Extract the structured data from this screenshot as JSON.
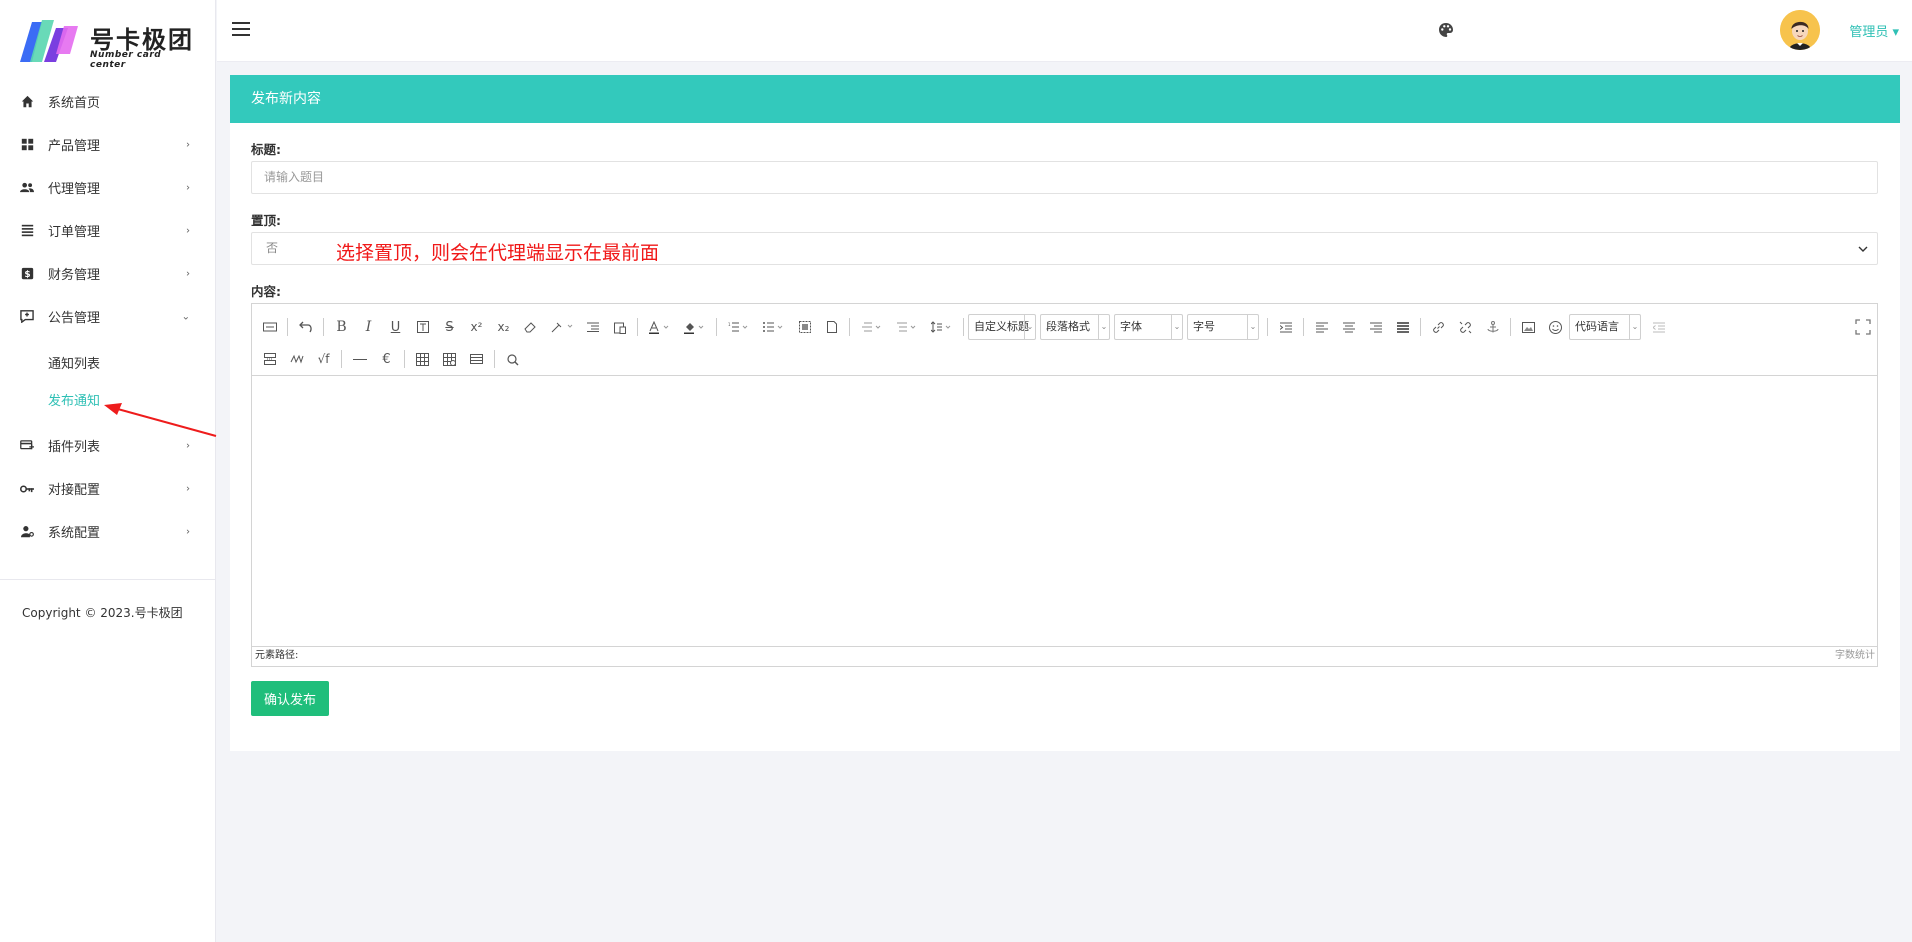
{
  "brand": {
    "title": "号卡极团",
    "subtitle": "Number card center"
  },
  "sidebar": {
    "items": [
      {
        "label": "系统首页",
        "icon": "home-icon",
        "chevron": ""
      },
      {
        "label": "产品管理",
        "icon": "grid-icon",
        "chevron": "›"
      },
      {
        "label": "代理管理",
        "icon": "users-icon",
        "chevron": "›"
      },
      {
        "label": "订单管理",
        "icon": "list-icon",
        "chevron": "›"
      },
      {
        "label": "财务管理",
        "icon": "dollar-icon",
        "chevron": "›"
      },
      {
        "label": "公告管理",
        "icon": "announcement-icon",
        "chevron": "⌄"
      }
    ],
    "sub_items": [
      {
        "label": "通知列表"
      },
      {
        "label": "发布通知"
      }
    ],
    "items_after": [
      {
        "label": "插件列表",
        "icon": "plugin-icon",
        "chevron": "›"
      },
      {
        "label": "对接配置",
        "icon": "key-icon",
        "chevron": "›"
      },
      {
        "label": "系统配置",
        "icon": "user-settings-icon",
        "chevron": "›"
      }
    ],
    "copyright": "Copyright © 2023.号卡极团"
  },
  "header": {
    "user_label": "管理员 ▾"
  },
  "panel": {
    "title": "发布新内容",
    "title_label": "标题:",
    "title_placeholder": "请输入题目",
    "top_label": "置顶:",
    "top_value": "否",
    "top_note": "选择置顶，则会在代理端显示在最前面",
    "content_label": "内容:",
    "submit_label": "确认发布"
  },
  "editor": {
    "combos": [
      {
        "label": "自定义标题"
      },
      {
        "label": "段落格式"
      },
      {
        "label": "字体"
      },
      {
        "label": "字号"
      },
      {
        "label": "代码语言"
      }
    ],
    "status_path": "元素路径:",
    "word_count": "字数统计"
  },
  "colors": {
    "accent": "#33c9bc",
    "active_text": "#2fc0b5",
    "submit": "#1fbe7b",
    "note": "#f01818"
  }
}
